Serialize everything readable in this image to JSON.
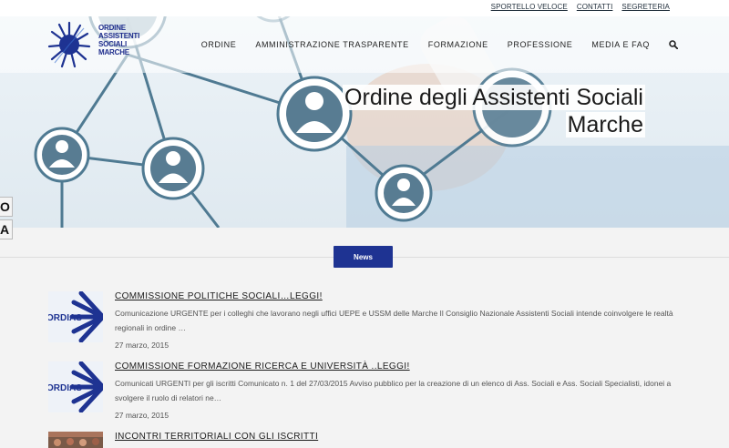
{
  "topbar": {
    "links": [
      "SPORTELLO VELOCE",
      "CONTATTI",
      "SEGRETERIA"
    ]
  },
  "logo": {
    "lines": [
      "ORDINE",
      "ASSISTENTI",
      "SOCIALI",
      "MARCHE"
    ]
  },
  "nav": {
    "items": [
      "ORDINE",
      "AMMINISTRAZIONE TRASPARENTE",
      "FORMAZIONE",
      "PROFESSIONE",
      "MEDIA E FAQ"
    ]
  },
  "hero": {
    "title_line1": "Ordine degli Assistenti Sociali",
    "title_line2": "Marche"
  },
  "accessibility": {
    "tab1": "O",
    "tab2": "A"
  },
  "news": {
    "label": "News",
    "articles": [
      {
        "title": "COMMISSIONE POLITICHE SOCIALI…LEGGI!",
        "body": "Comunicazione URGENTE per i colleghi  che lavorano  negli uffici UEPE  e USSM  delle Marche       Il Consiglio Nazionale Assistenti Sociali intende coinvolgere le realtà regionali in ordine …",
        "date": "27 marzo, 2015",
        "thumb_text": "ORDIAS"
      },
      {
        "title": "COMMISSIONE FORMAZIONE RICERCA E UNIVERSITÀ ..LEGGI!",
        "body": "Comunicati URGENTI per gli iscritti Comunicato  n. 1 del 27/03/2015 Avviso pubblico per la creazione di un elenco di Ass. Sociali e Ass. Sociali Specialisti, idonei a svolgere il ruolo di relatori ne…",
        "date": "27 marzo, 2015",
        "thumb_text": "ORDIAS"
      },
      {
        "title": "INCONTRI TERRITORIALI CON GLI ISCRITTI",
        "body": "",
        "date": ""
      }
    ]
  },
  "colors": {
    "brand_blue": "#1e3392",
    "node_blue": "#5f7f95"
  }
}
